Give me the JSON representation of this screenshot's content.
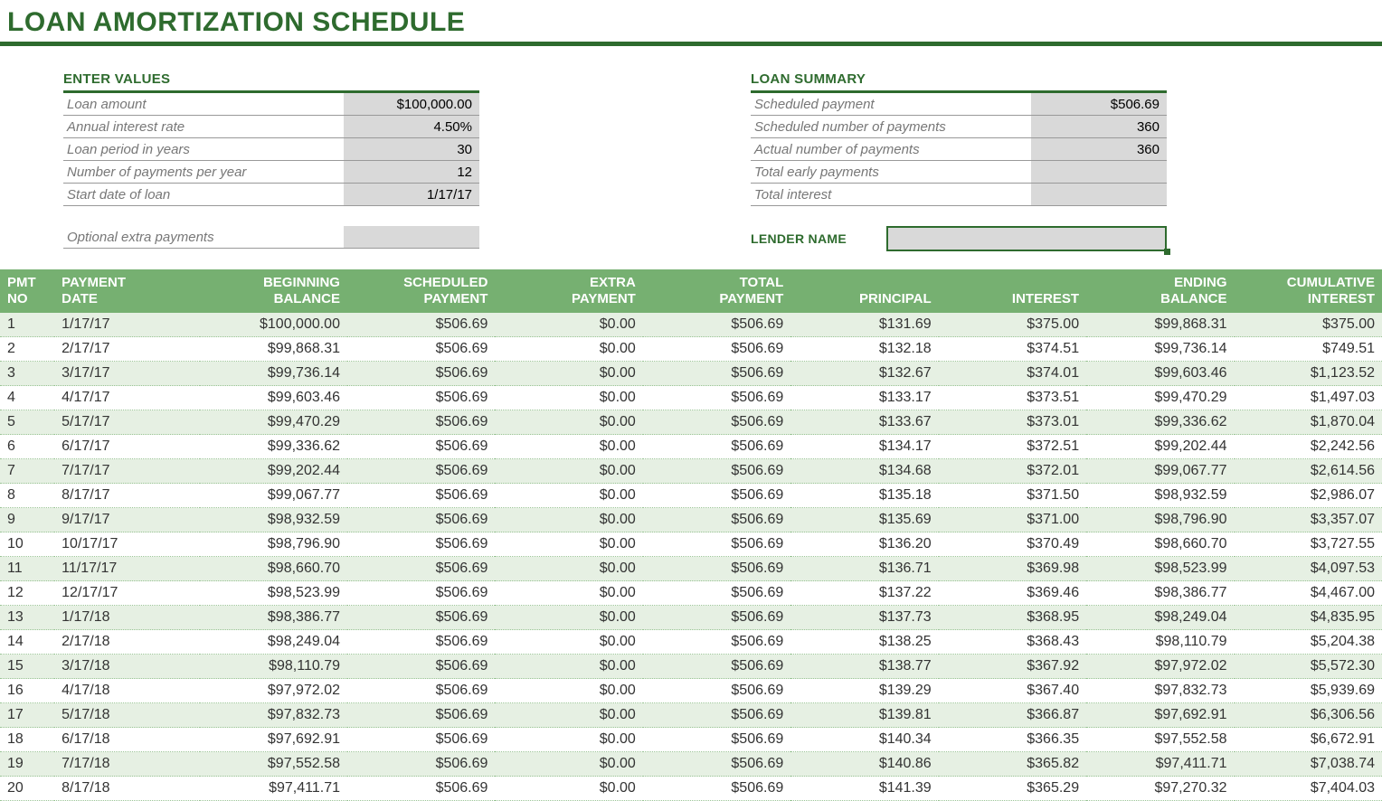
{
  "title": "LOAN AMORTIZATION SCHEDULE",
  "enter_values": {
    "header": "ENTER VALUES",
    "rows": [
      {
        "label": "Loan amount",
        "value": "$100,000.00"
      },
      {
        "label": "Annual interest rate",
        "value": "4.50%"
      },
      {
        "label": "Loan period in years",
        "value": "30"
      },
      {
        "label": "Number of payments per year",
        "value": "12"
      },
      {
        "label": "Start date of loan",
        "value": "1/17/17"
      }
    ],
    "extra": {
      "label": "Optional extra payments",
      "value": ""
    }
  },
  "loan_summary": {
    "header": "LOAN SUMMARY",
    "rows": [
      {
        "label": "Scheduled payment",
        "value": "$506.69"
      },
      {
        "label": "Scheduled number of payments",
        "value": "360"
      },
      {
        "label": "Actual number of payments",
        "value": "360"
      },
      {
        "label": "Total early payments",
        "value": ""
      },
      {
        "label": "Total interest",
        "value": ""
      }
    ],
    "lender_label": "LENDER NAME",
    "lender_value": ""
  },
  "schedule": {
    "headers": {
      "pmt_no": "PMT NO",
      "payment_date": "PAYMENT DATE",
      "beg_balance": "BEGINNING BALANCE",
      "sched_payment": "SCHEDULED PAYMENT",
      "extra_payment": "EXTRA PAYMENT",
      "total_payment": "TOTAL PAYMENT",
      "principal": "PRINCIPAL",
      "interest": "INTEREST",
      "end_balance": "ENDING BALANCE",
      "cum_interest": "CUMULATIVE INTEREST"
    },
    "rows": [
      {
        "no": "1",
        "date": "1/17/17",
        "beg": "$100,000.00",
        "sched": "$506.69",
        "extra": "$0.00",
        "total": "$506.69",
        "prin": "$131.69",
        "int": "$375.00",
        "end": "$99,868.31",
        "cum": "$375.00"
      },
      {
        "no": "2",
        "date": "2/17/17",
        "beg": "$99,868.31",
        "sched": "$506.69",
        "extra": "$0.00",
        "total": "$506.69",
        "prin": "$132.18",
        "int": "$374.51",
        "end": "$99,736.14",
        "cum": "$749.51"
      },
      {
        "no": "3",
        "date": "3/17/17",
        "beg": "$99,736.14",
        "sched": "$506.69",
        "extra": "$0.00",
        "total": "$506.69",
        "prin": "$132.67",
        "int": "$374.01",
        "end": "$99,603.46",
        "cum": "$1,123.52"
      },
      {
        "no": "4",
        "date": "4/17/17",
        "beg": "$99,603.46",
        "sched": "$506.69",
        "extra": "$0.00",
        "total": "$506.69",
        "prin": "$133.17",
        "int": "$373.51",
        "end": "$99,470.29",
        "cum": "$1,497.03"
      },
      {
        "no": "5",
        "date": "5/17/17",
        "beg": "$99,470.29",
        "sched": "$506.69",
        "extra": "$0.00",
        "total": "$506.69",
        "prin": "$133.67",
        "int": "$373.01",
        "end": "$99,336.62",
        "cum": "$1,870.04"
      },
      {
        "no": "6",
        "date": "6/17/17",
        "beg": "$99,336.62",
        "sched": "$506.69",
        "extra": "$0.00",
        "total": "$506.69",
        "prin": "$134.17",
        "int": "$372.51",
        "end": "$99,202.44",
        "cum": "$2,242.56"
      },
      {
        "no": "7",
        "date": "7/17/17",
        "beg": "$99,202.44",
        "sched": "$506.69",
        "extra": "$0.00",
        "total": "$506.69",
        "prin": "$134.68",
        "int": "$372.01",
        "end": "$99,067.77",
        "cum": "$2,614.56"
      },
      {
        "no": "8",
        "date": "8/17/17",
        "beg": "$99,067.77",
        "sched": "$506.69",
        "extra": "$0.00",
        "total": "$506.69",
        "prin": "$135.18",
        "int": "$371.50",
        "end": "$98,932.59",
        "cum": "$2,986.07"
      },
      {
        "no": "9",
        "date": "9/17/17",
        "beg": "$98,932.59",
        "sched": "$506.69",
        "extra": "$0.00",
        "total": "$506.69",
        "prin": "$135.69",
        "int": "$371.00",
        "end": "$98,796.90",
        "cum": "$3,357.07"
      },
      {
        "no": "10",
        "date": "10/17/17",
        "beg": "$98,796.90",
        "sched": "$506.69",
        "extra": "$0.00",
        "total": "$506.69",
        "prin": "$136.20",
        "int": "$370.49",
        "end": "$98,660.70",
        "cum": "$3,727.55"
      },
      {
        "no": "11",
        "date": "11/17/17",
        "beg": "$98,660.70",
        "sched": "$506.69",
        "extra": "$0.00",
        "total": "$506.69",
        "prin": "$136.71",
        "int": "$369.98",
        "end": "$98,523.99",
        "cum": "$4,097.53"
      },
      {
        "no": "12",
        "date": "12/17/17",
        "beg": "$98,523.99",
        "sched": "$506.69",
        "extra": "$0.00",
        "total": "$506.69",
        "prin": "$137.22",
        "int": "$369.46",
        "end": "$98,386.77",
        "cum": "$4,467.00"
      },
      {
        "no": "13",
        "date": "1/17/18",
        "beg": "$98,386.77",
        "sched": "$506.69",
        "extra": "$0.00",
        "total": "$506.69",
        "prin": "$137.73",
        "int": "$368.95",
        "end": "$98,249.04",
        "cum": "$4,835.95"
      },
      {
        "no": "14",
        "date": "2/17/18",
        "beg": "$98,249.04",
        "sched": "$506.69",
        "extra": "$0.00",
        "total": "$506.69",
        "prin": "$138.25",
        "int": "$368.43",
        "end": "$98,110.79",
        "cum": "$5,204.38"
      },
      {
        "no": "15",
        "date": "3/17/18",
        "beg": "$98,110.79",
        "sched": "$506.69",
        "extra": "$0.00",
        "total": "$506.69",
        "prin": "$138.77",
        "int": "$367.92",
        "end": "$97,972.02",
        "cum": "$5,572.30"
      },
      {
        "no": "16",
        "date": "4/17/18",
        "beg": "$97,972.02",
        "sched": "$506.69",
        "extra": "$0.00",
        "total": "$506.69",
        "prin": "$139.29",
        "int": "$367.40",
        "end": "$97,832.73",
        "cum": "$5,939.69"
      },
      {
        "no": "17",
        "date": "5/17/18",
        "beg": "$97,832.73",
        "sched": "$506.69",
        "extra": "$0.00",
        "total": "$506.69",
        "prin": "$139.81",
        "int": "$366.87",
        "end": "$97,692.91",
        "cum": "$6,306.56"
      },
      {
        "no": "18",
        "date": "6/17/18",
        "beg": "$97,692.91",
        "sched": "$506.69",
        "extra": "$0.00",
        "total": "$506.69",
        "prin": "$140.34",
        "int": "$366.35",
        "end": "$97,552.58",
        "cum": "$6,672.91"
      },
      {
        "no": "19",
        "date": "7/17/18",
        "beg": "$97,552.58",
        "sched": "$506.69",
        "extra": "$0.00",
        "total": "$506.69",
        "prin": "$140.86",
        "int": "$365.82",
        "end": "$97,411.71",
        "cum": "$7,038.74"
      },
      {
        "no": "20",
        "date": "8/17/18",
        "beg": "$97,411.71",
        "sched": "$506.69",
        "extra": "$0.00",
        "total": "$506.69",
        "prin": "$141.39",
        "int": "$365.29",
        "end": "$97,270.32",
        "cum": "$7,404.03"
      }
    ]
  },
  "chart_data": {
    "type": "table",
    "title": "Loan Amortization Schedule",
    "columns": [
      "PMT NO",
      "PAYMENT DATE",
      "BEGINNING BALANCE",
      "SCHEDULED PAYMENT",
      "EXTRA PAYMENT",
      "TOTAL PAYMENT",
      "PRINCIPAL",
      "INTEREST",
      "ENDING BALANCE",
      "CUMULATIVE INTEREST"
    ],
    "parameters": {
      "loan_amount": 100000.0,
      "annual_interest_rate": 0.045,
      "loan_period_years": 30,
      "payments_per_year": 12,
      "start_date": "2017-01-17",
      "scheduled_payment": 506.69,
      "scheduled_number_of_payments": 360,
      "actual_number_of_payments": 360
    }
  }
}
